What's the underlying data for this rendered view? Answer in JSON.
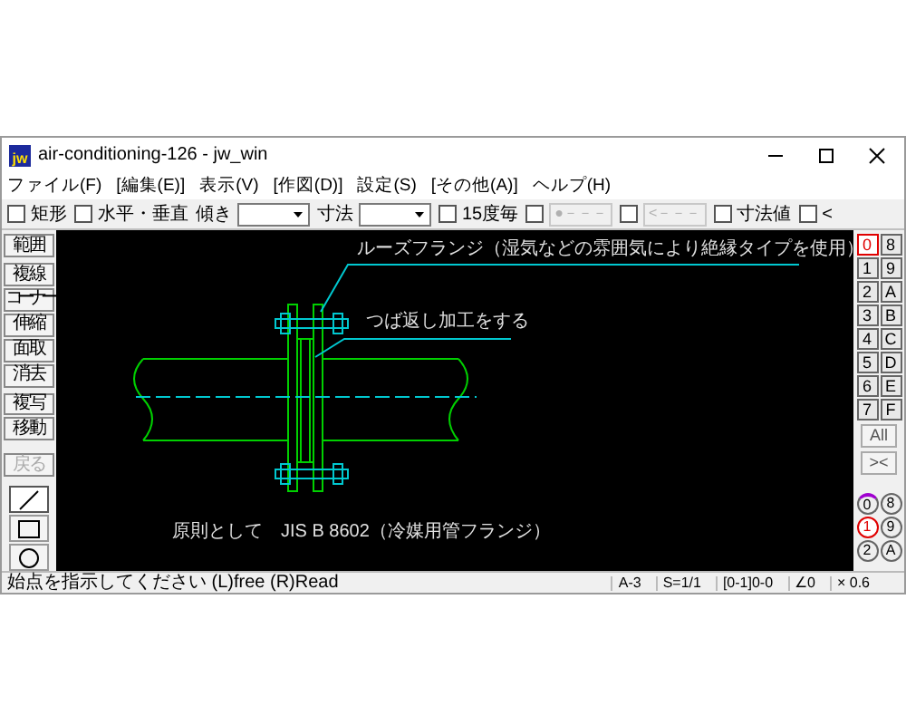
{
  "window": {
    "app_icon": "jw",
    "title": "air-conditioning-126 - jw_win"
  },
  "menu": [
    "ファイル(F)",
    "[編集(E)]",
    "表示(V)",
    "[作図(D)]",
    "設定(S)",
    "[その他(A)]",
    "ヘルプ(H)"
  ],
  "toolbar": [
    {
      "kind": "check",
      "label": "矩形",
      "checked": false
    },
    {
      "kind": "check",
      "label": "水平・垂直",
      "checked": false
    },
    {
      "kind": "select",
      "label": "傾き"
    },
    {
      "kind": "select",
      "label": "寸法"
    },
    {
      "kind": "check",
      "label": "15度毎",
      "checked": false
    },
    {
      "kind": "check_button",
      "checked": false,
      "button": "●－－－",
      "disabled": true
    },
    {
      "kind": "check_button",
      "checked": false,
      "button": "<－－－",
      "disabled": true
    },
    {
      "kind": "check",
      "label": "寸法値",
      "checked": false
    },
    {
      "kind": "check",
      "label": "<",
      "checked": false
    }
  ],
  "tools": [
    {
      "label": "範囲",
      "disabled": false
    },
    {
      "label": "複線",
      "disabled": false
    },
    {
      "label": "コーナー",
      "disabled": false
    },
    {
      "label": "伸縮",
      "disabled": false
    },
    {
      "label": "面取",
      "disabled": false
    },
    {
      "label": "消去",
      "disabled": false
    },
    {
      "label": "複写",
      "disabled": false
    },
    {
      "label": "移動",
      "disabled": false
    },
    {
      "label": "戻る",
      "disabled": true
    }
  ],
  "shape_tools": [
    {
      "kind": "line",
      "selected": true
    },
    {
      "kind": "rect",
      "selected": false
    },
    {
      "kind": "circle",
      "selected": false
    }
  ],
  "canvas": {
    "labels": [
      "ルーズフランジ（湿気などの雰囲気により絶縁タイプを使用）",
      "つば返し加工をする",
      "原則として　JIS B 8602（冷媒用管フランジ）"
    ]
  },
  "layers": [
    {
      "label": "0",
      "selected": true
    },
    {
      "label": "8",
      "selected": false
    },
    {
      "label": "1",
      "selected": false
    },
    {
      "label": "9",
      "selected": false
    },
    {
      "label": "2",
      "selected": false
    },
    {
      "label": "A",
      "selected": false
    },
    {
      "label": "3",
      "selected": false
    },
    {
      "label": "B",
      "selected": false
    },
    {
      "label": "4",
      "selected": false
    },
    {
      "label": "C",
      "selected": false
    },
    {
      "label": "5",
      "selected": false
    },
    {
      "label": "D",
      "selected": false
    },
    {
      "label": "6",
      "selected": false
    },
    {
      "label": "E",
      "selected": false
    },
    {
      "label": "7",
      "selected": false
    },
    {
      "label": "F",
      "selected": false
    }
  ],
  "layer_buttons": [
    "All",
    "><"
  ],
  "groups": [
    {
      "label": "0",
      "selected": false,
      "marked": true
    },
    {
      "label": "8",
      "selected": false,
      "marked": false
    },
    {
      "label": "1",
      "selected": true,
      "marked": false
    },
    {
      "label": "9",
      "selected": false,
      "marked": false
    },
    {
      "label": "2",
      "selected": false,
      "marked": false
    },
    {
      "label": "A",
      "selected": false,
      "marked": false
    }
  ],
  "status_bar": {
    "message": "始点を指示してください (L)free (R)Read",
    "fields": [
      "A-3",
      "S=1/1",
      "[0-1]0-0",
      "∠0",
      "× 0.6"
    ]
  }
}
